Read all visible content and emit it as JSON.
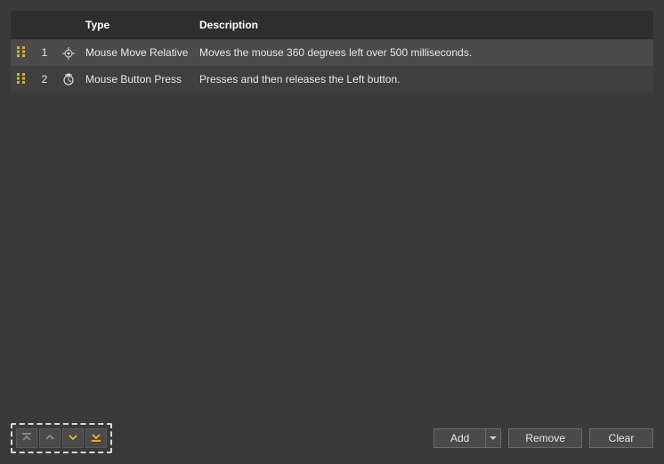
{
  "columns": {
    "type": "Type",
    "description": "Description"
  },
  "rows": [
    {
      "number": "1",
      "icon": "mouse-move-icon",
      "type": "Mouse Move Relative",
      "description": "Moves the mouse 360 degrees left over 500 milliseconds."
    },
    {
      "number": "2",
      "icon": "mouse-button-icon",
      "type": "Mouse Button Press",
      "description": "Presses and then releases the Left button."
    }
  ],
  "buttons": {
    "add": "Add",
    "remove": "Remove",
    "clear": "Clear"
  }
}
